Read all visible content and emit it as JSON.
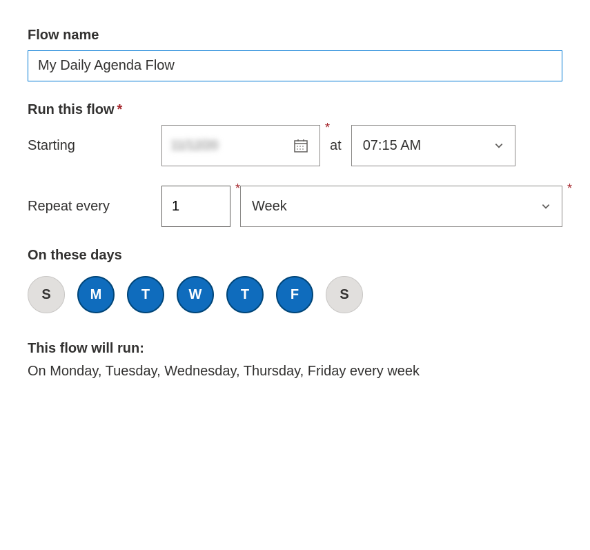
{
  "flowName": {
    "label": "Flow name",
    "value": "My Daily Agenda Flow"
  },
  "runSection": {
    "label": "Run this flow",
    "startingLabel": "Starting",
    "dateValue": "11/12/20",
    "atLabel": "at",
    "timeValue": "07:15 AM",
    "repeatLabel": "Repeat every",
    "repeatCount": "1",
    "repeatUnit": "Week"
  },
  "daysSection": {
    "label": "On these days",
    "days": [
      {
        "letter": "S",
        "selected": false
      },
      {
        "letter": "M",
        "selected": true
      },
      {
        "letter": "T",
        "selected": true
      },
      {
        "letter": "W",
        "selected": true
      },
      {
        "letter": "T",
        "selected": true
      },
      {
        "letter": "F",
        "selected": true
      },
      {
        "letter": "S",
        "selected": false
      }
    ]
  },
  "summary": {
    "label": "This flow will run:",
    "text": "On Monday, Tuesday, Wednesday, Thursday, Friday every week"
  },
  "requiredMark": "*"
}
